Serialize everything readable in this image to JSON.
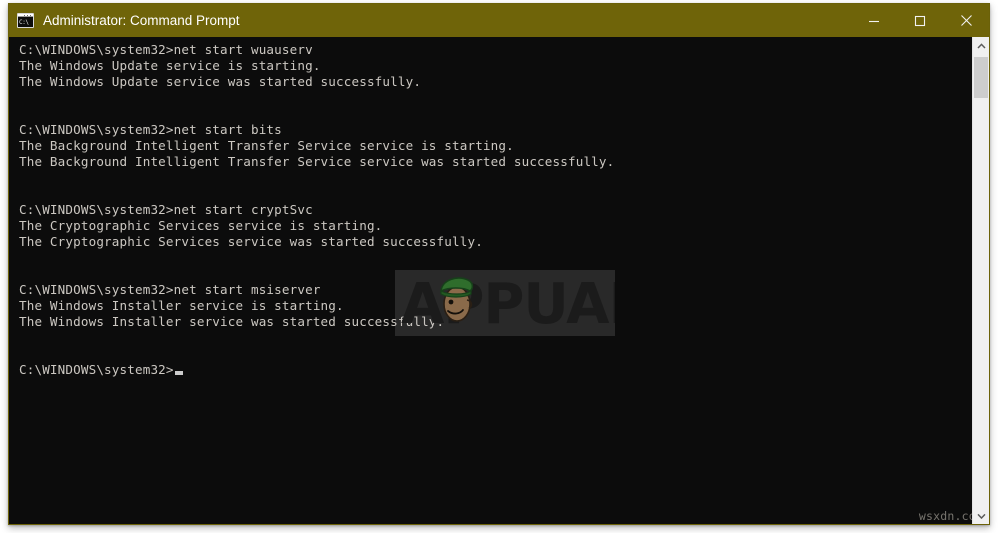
{
  "window": {
    "title": "Administrator: Command Prompt",
    "icon_name": "cmd-icon",
    "icon_text": "C:\\",
    "titlebar_color": "#6f6409",
    "console_bg": "#0c0c0c",
    "console_fg": "#ccc8c2",
    "controls": {
      "minimize_label": "Minimize",
      "maximize_label": "Maximize",
      "close_label": "Close"
    }
  },
  "console": {
    "lines": [
      "C:\\WINDOWS\\system32>net start wuauserv",
      "The Windows Update service is starting.",
      "The Windows Update service was started successfully.",
      "",
      "",
      "C:\\WINDOWS\\system32>net start bits",
      "The Background Intelligent Transfer Service service is starting.",
      "The Background Intelligent Transfer Service service was started successfully.",
      "",
      "",
      "C:\\WINDOWS\\system32>net start cryptSvc",
      "The Cryptographic Services service is starting.",
      "The Cryptographic Services service was started successfully.",
      "",
      "",
      "C:\\WINDOWS\\system32>net start msiserver",
      "The Windows Installer service is starting.",
      "The Windows Installer service was started successfully.",
      "",
      ""
    ],
    "prompt": "C:\\WINDOWS\\system32>",
    "cursor": "block-cursor"
  },
  "scrollbar": {
    "up_arrow": "chevron-up-icon",
    "down_arrow": "chevron-down-icon",
    "thumb_label": "scroll-thumb"
  },
  "watermarks": {
    "logo_text": "APPUALS",
    "mascot": "appuals-mascot",
    "site": "wsxdn.com"
  }
}
